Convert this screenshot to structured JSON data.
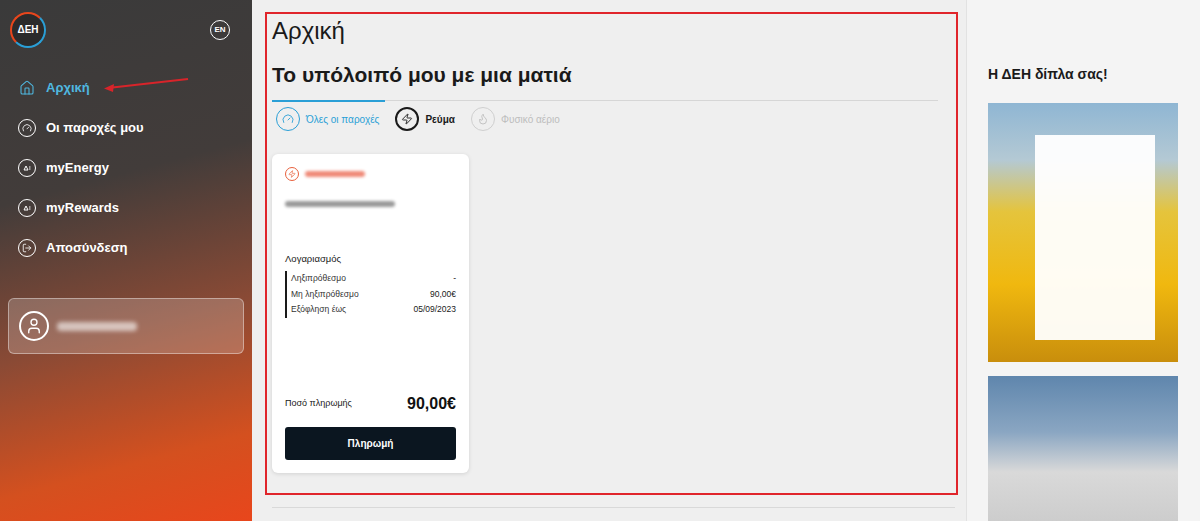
{
  "logo": {
    "text": "ΔΕΗ"
  },
  "language_button": "EN",
  "sidebar": {
    "items": [
      {
        "label": "Αρχική",
        "selected": true
      },
      {
        "label": "Οι παροχές μου",
        "selected": false
      },
      {
        "label": "myEnergy",
        "selected": false
      },
      {
        "label": "myRewards",
        "selected": false
      },
      {
        "label": "Αποσύνδεση",
        "selected": false
      }
    ]
  },
  "page": {
    "title": "Αρχική",
    "subtitle": "Το υπόλοιπό μου με μια ματιά"
  },
  "tabs": [
    {
      "label": "Όλες οι παροχές",
      "selected": true,
      "disabled": false
    },
    {
      "label": "Ρεύμα",
      "selected": false,
      "disabled": false
    },
    {
      "label": "Φυσικό αέριο",
      "selected": false,
      "disabled": true
    }
  ],
  "supply_card": {
    "section": "Λογαριασμός",
    "rows": [
      {
        "label": "Ληξιπρόθεσμο",
        "value": "-"
      },
      {
        "label": "Μη ληξιπρόθεσμο",
        "value": "90,00€"
      },
      {
        "label": "Εξόφληση έως",
        "value": "05/09/2023"
      }
    ],
    "amount_label": "Ποσό πληρωμής",
    "amount": "90,00€",
    "button": "Πληρωμή"
  },
  "promo": {
    "title": "Η ΔΕΗ δίπλα σας!"
  }
}
